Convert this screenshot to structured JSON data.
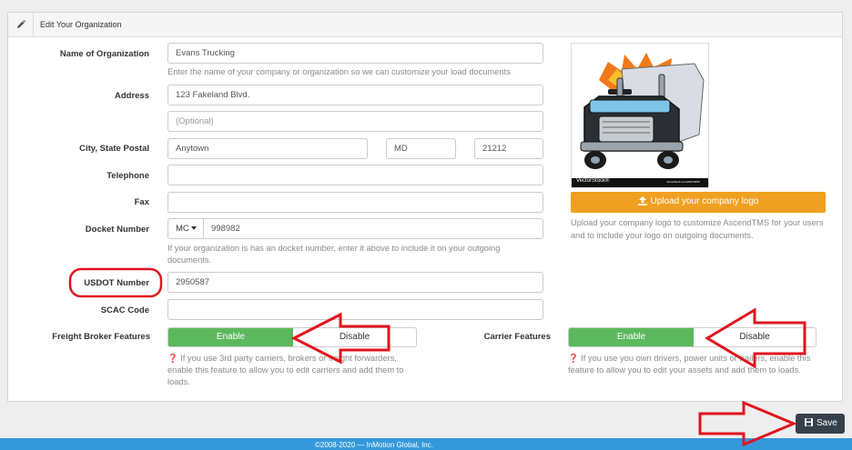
{
  "panel": {
    "title": "Edit Your Organization",
    "edit_icon": "pencil-icon"
  },
  "form": {
    "org_name": {
      "label": "Name of Organization",
      "value": "Evans Trucking",
      "help": "Enter the name of your company or organization so we can customize your load documents"
    },
    "address": {
      "label": "Address",
      "line1": "123 Fakeland Blvd.",
      "line2_placeholder": "(Optional)"
    },
    "city_state_postal": {
      "label": "City, State Postal",
      "city": "Anytown",
      "state": "MD",
      "postal": "21212"
    },
    "telephone": {
      "label": "Telephone",
      "value": ""
    },
    "fax": {
      "label": "Fax",
      "value": ""
    },
    "docket": {
      "label": "Docket Number",
      "type": "MC",
      "value": "998982",
      "help": "If your organization is has an docket number, enter it above to include it on your outgoing documents."
    },
    "usdot": {
      "label": "USDOT Number",
      "value": "2950587"
    },
    "scac": {
      "label": "SCAC Code",
      "value": ""
    },
    "freight_broker": {
      "label": "Freight Broker Features",
      "enable": "Enable",
      "disable": "Disable",
      "help": "If you use 3rd party carriers, brokers or freight forwarders, enable this feature to allow you to edit carriers and add them to loads."
    },
    "carrier": {
      "label": "Carrier Features",
      "enable": "Enable",
      "disable": "Disable",
      "help": "If you use you own drivers, power units or trailers, enable this feature to allow you to edit your assets and add them to loads."
    }
  },
  "logo": {
    "watermark_left": "VectorStock®",
    "watermark_right": "VectorStock.com/20470256",
    "upload_label": "Upload your company logo",
    "help": "Upload your company logo to customize AscendTMS for your users and to include your logo on outgoing documents."
  },
  "actions": {
    "save_label": "Save"
  },
  "footer": {
    "text": "©2008-2020 — InMotion Global, Inc."
  },
  "colors": {
    "enable": "#5cb85c",
    "upload": "#f0a020",
    "save": "#36404a",
    "footer": "#3498db",
    "annotation": "#e0141e"
  }
}
